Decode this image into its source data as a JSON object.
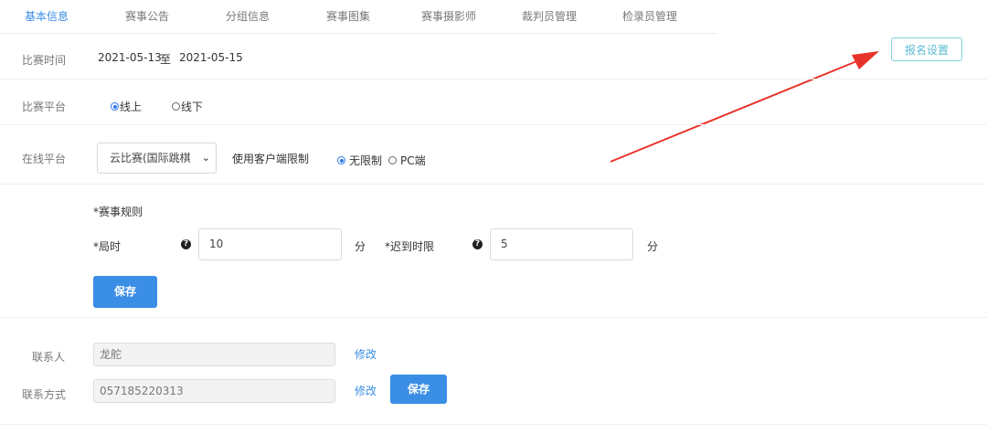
{
  "tabs": [
    {
      "label": "基本信息",
      "active": true
    },
    {
      "label": "赛事公告"
    },
    {
      "label": "分组信息"
    },
    {
      "label": "赛事图集"
    },
    {
      "label": "赛事摄影师"
    },
    {
      "label": "裁判员管理"
    },
    {
      "label": "检录员管理"
    }
  ],
  "register_settings_label": "报名设置",
  "match_time": {
    "label": "比赛时间",
    "start": "2021-05-13",
    "sep": "至",
    "end": "2021-05-15"
  },
  "platform": {
    "label": "比赛平台",
    "options": [
      {
        "label": "线上",
        "checked": true
      },
      {
        "label": "线下",
        "checked": false
      }
    ]
  },
  "online_platform": {
    "label": "在线平台",
    "selected": "云比赛(国际跳棋",
    "client_limit_label": "使用客户端限制",
    "client_options": [
      {
        "label": "无限制",
        "checked": true
      },
      {
        "label": "PC端",
        "checked": false
      }
    ]
  },
  "rules": {
    "title": "*赛事规则",
    "game_time_label": "*局时",
    "game_time_value": "10",
    "late_limit_label": "*迟到时限",
    "late_limit_value": "5",
    "unit": "分",
    "help_icon": "question-circle-icon",
    "save_label": "保存"
  },
  "contact": {
    "person_label": "联系人",
    "person_value": "龙舵",
    "phone_label": "联系方式",
    "phone_value": "057185220313",
    "edit_label": "修改",
    "save_label": "保存"
  },
  "colors": {
    "accent": "#3a8ee6",
    "annotation_arrow": "#e8332a",
    "register_border": "#7fd0e0"
  }
}
